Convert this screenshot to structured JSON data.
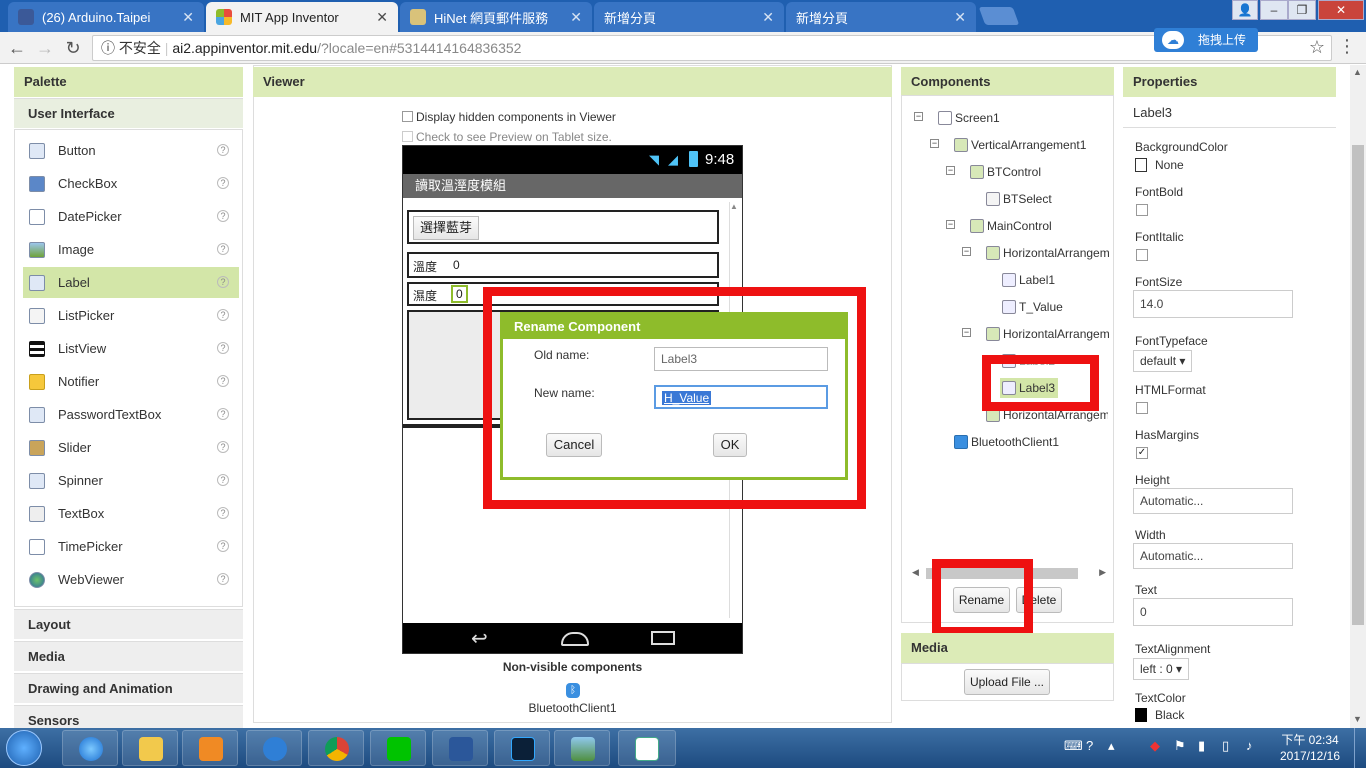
{
  "browser": {
    "tabs": [
      {
        "title": "(26) Arduino.Taipei",
        "icon": "facebook-icon"
      },
      {
        "title": "MIT App Inventor",
        "icon": "app-inventor-icon",
        "active": true
      },
      {
        "title": "HiNet 網頁郵件服務",
        "icon": "mail-icon"
      },
      {
        "title": "新增分頁",
        "icon": "blank-page-icon"
      },
      {
        "title": "新增分頁",
        "icon": "blank-page-icon"
      }
    ],
    "security": "不安全",
    "url_host": "ai2.appinventor.mit.edu",
    "url_path": "/?locale=en#5314414164836352",
    "extension_label": "拖拽上传"
  },
  "palette": {
    "title": "Palette",
    "active_section": "User Interface",
    "items": [
      {
        "label": "Button",
        "icon": "button-icon"
      },
      {
        "label": "CheckBox",
        "icon": "checkbox-icon"
      },
      {
        "label": "DatePicker",
        "icon": "datepicker-icon"
      },
      {
        "label": "Image",
        "icon": "image-icon"
      },
      {
        "label": "Label",
        "icon": "label-icon",
        "selected": true
      },
      {
        "label": "ListPicker",
        "icon": "listpicker-icon"
      },
      {
        "label": "ListView",
        "icon": "listview-icon"
      },
      {
        "label": "Notifier",
        "icon": "notifier-icon"
      },
      {
        "label": "PasswordTextBox",
        "icon": "password-icon"
      },
      {
        "label": "Slider",
        "icon": "slider-icon"
      },
      {
        "label": "Spinner",
        "icon": "spinner-icon"
      },
      {
        "label": "TextBox",
        "icon": "textbox-icon"
      },
      {
        "label": "TimePicker",
        "icon": "timepicker-icon"
      },
      {
        "label": "WebViewer",
        "icon": "webviewer-icon"
      }
    ],
    "help": "?",
    "sections": [
      "Layout",
      "Media",
      "Drawing and Animation",
      "Sensors"
    ]
  },
  "viewer": {
    "title": "Viewer",
    "hidden_components": "Display hidden components in Viewer",
    "tablet_preview": "Check to see Preview on Tablet size.",
    "phone": {
      "time": "9:48",
      "app_title": "讀取溫溼度模組",
      "bt_button": "選擇藍芽",
      "temp_label": "溫度",
      "temp_value": "0",
      "hum_label": "濕度",
      "hum_value": "0"
    },
    "nonvisible_title": "Non-visible components",
    "nonvisible_item": "BluetoothClient1"
  },
  "dialog": {
    "title": "Rename Component",
    "old_label": "Old name:",
    "old_value": "Label3",
    "new_label": "New name:",
    "new_value": "H_Value",
    "cancel": "Cancel",
    "ok": "OK"
  },
  "components": {
    "title": "Components",
    "tree": [
      {
        "label": "Screen1",
        "depth": 0,
        "toggle": "−"
      },
      {
        "label": "VerticalArrangement1",
        "depth": 1,
        "toggle": "−"
      },
      {
        "label": "BTControl",
        "depth": 2,
        "toggle": "−"
      },
      {
        "label": "BTSelect",
        "depth": 3,
        "toggle": ""
      },
      {
        "label": "MainControl",
        "depth": 2,
        "toggle": "−"
      },
      {
        "label": "HorizontalArrangem",
        "depth": 3,
        "toggle": "−"
      },
      {
        "label": "Label1",
        "depth": 4,
        "toggle": ""
      },
      {
        "label": "T_Value",
        "depth": 4,
        "toggle": ""
      },
      {
        "label": "HorizontalArrangem",
        "depth": 3,
        "toggle": "−"
      },
      {
        "label": "Label2",
        "depth": 4,
        "toggle": "",
        "obscured": true
      },
      {
        "label": "Label3",
        "depth": 4,
        "toggle": "",
        "selected": true
      },
      {
        "label": "HorizontalArrangem",
        "depth": 3,
        "toggle": ""
      },
      {
        "label": "BluetoothClient1",
        "depth": 1,
        "toggle": ""
      }
    ],
    "rename": "Rename",
    "delete": "Delete"
  },
  "media": {
    "title": "Media",
    "upload": "Upload File ..."
  },
  "properties": {
    "title": "Properties",
    "component": "Label3",
    "bg_label": "BackgroundColor",
    "bg_value": "None",
    "bold_label": "FontBold",
    "italic_label": "FontItalic",
    "size_label": "FontSize",
    "size_value": "14.0",
    "typeface_label": "FontTypeface",
    "typeface_value": "default ▾",
    "html_label": "HTMLFormat",
    "margins_label": "HasMargins",
    "height_label": "Height",
    "height_value": "Automatic...",
    "width_label": "Width",
    "width_value": "Automatic...",
    "text_label": "Text",
    "text_value": "0",
    "align_label": "TextAlignment",
    "align_value": "left : 0 ▾",
    "color_label": "TextColor",
    "color_value": "Black"
  },
  "taskbar": {
    "clock_period_time": "下午 02:34",
    "clock_date": "2017/12/16",
    "apps": [
      "ie-icon",
      "explorer-icon",
      "media-player-icon",
      "baidu-cloud-icon",
      "chrome-icon",
      "line-icon",
      "word-icon",
      "photoshop-icon",
      "photos-icon",
      "arduino-icon"
    ]
  },
  "colors": {
    "accent_green": "#8ebc2b",
    "highlight_red": "#ee1111",
    "header_green": "#dcebb7"
  }
}
